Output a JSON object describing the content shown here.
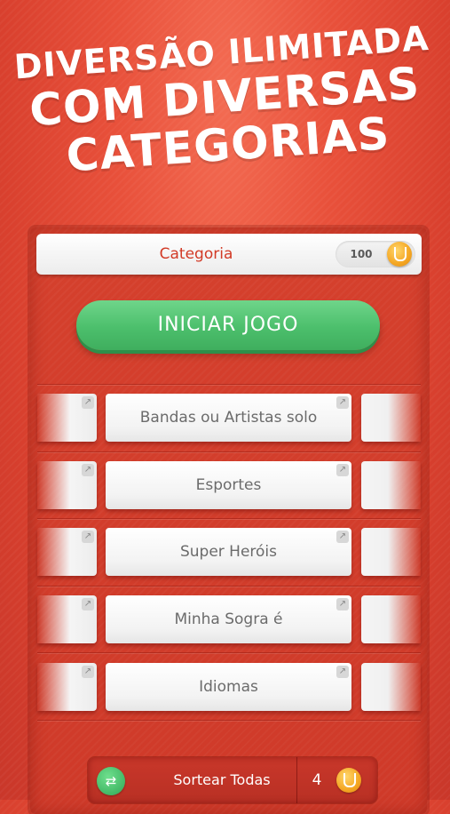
{
  "headline": {
    "line1": "DIVERSÃO ILIMITADA",
    "line2": "COM DIVERSAS",
    "line3": "CATEGORIAS"
  },
  "header": {
    "title": "Categoria",
    "coins": "100",
    "coin_icon": "coin-icon"
  },
  "start_button": {
    "label": "INICIAR JOGO",
    "color": "#4cbf6c"
  },
  "categories": [
    {
      "label": "Bandas ou Artistas solo"
    },
    {
      "label": "Esportes"
    },
    {
      "label": "Super Heróis"
    },
    {
      "label": "Minha Sogra é"
    },
    {
      "label": "Idiomas"
    }
  ],
  "card_corner_icon": "expand-arrow-icon",
  "bottom_bar": {
    "shuffle_label": "Sortear Todas",
    "shuffle_cost": "4",
    "shuffle_icon": "shuffle-icon",
    "coin_icon": "coin-icon"
  },
  "colors": {
    "background": "#e8503a",
    "accent_red": "#d23a26",
    "green": "#4cbf6c",
    "coin": "#f4a623"
  }
}
